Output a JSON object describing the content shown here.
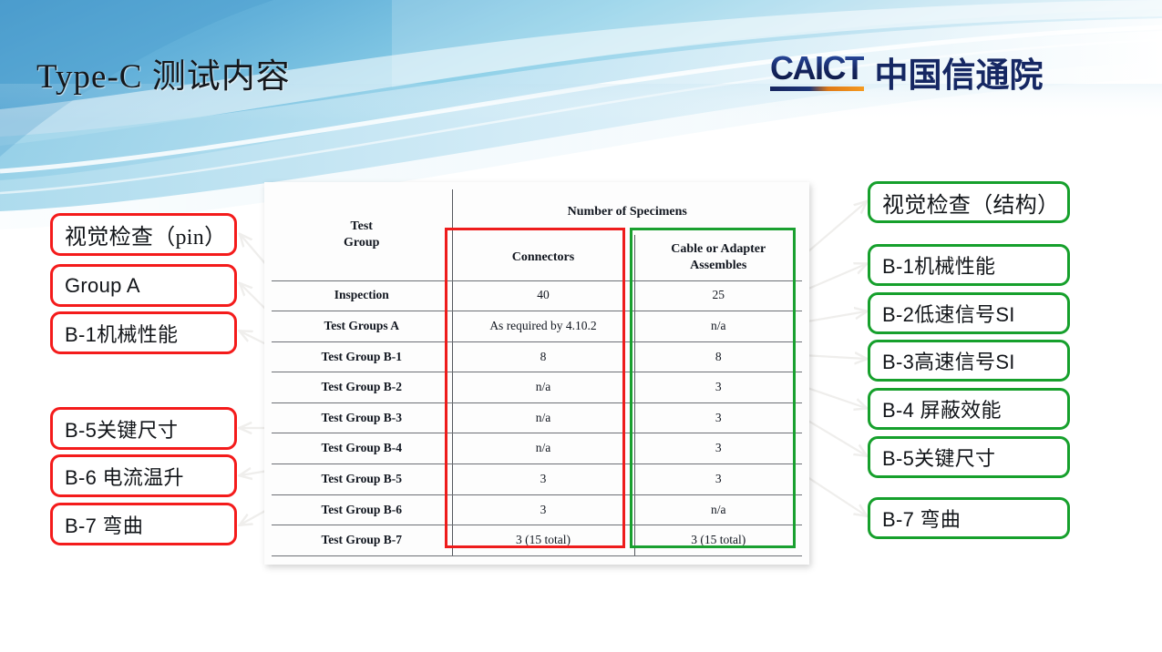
{
  "slide": {
    "title": "Type-C 测试内容",
    "logo": {
      "wordmark": "CAICT",
      "chinese_name": "中国信通院",
      "wordmark_color": "#15255f",
      "accent_color": "#f59a20"
    },
    "background": {
      "theme": "blue-swoosh-gradient",
      "primary": "#6cb4dd",
      "secondary": "#8fd3ea",
      "page": "#ffffff"
    }
  },
  "table": {
    "header_row_1": {
      "test_group": "Test\nGroup",
      "number_of_specimens": "Number of Specimens"
    },
    "header_row_2": {
      "connectors": "Connectors",
      "cable_or_adapter": "Cable or Adapter\nAssembles"
    },
    "columns": [
      "Test Group",
      "Connectors",
      "Cable or Adapter Assembles"
    ],
    "rows": [
      {
        "group": "Inspection",
        "connectors": "40",
        "cable": "25"
      },
      {
        "group": "Test Groups A",
        "connectors": "As required by 4.10.2",
        "cable": "n/a"
      },
      {
        "group": "Test Group B-1",
        "connectors": "8",
        "cable": "8"
      },
      {
        "group": "Test Group B-2",
        "connectors": "n/a",
        "cable": "3"
      },
      {
        "group": "Test Group B-3",
        "connectors": "n/a",
        "cable": "3"
      },
      {
        "group": "Test Group B-4",
        "connectors": "n/a",
        "cable": "3"
      },
      {
        "group": "Test Group B-5",
        "connectors": "3",
        "cable": "3"
      },
      {
        "group": "Test Group B-6",
        "connectors": "3",
        "cable": "n/a"
      },
      {
        "group": "Test Group B-7",
        "connectors": "3 (15 total)",
        "cable": "3 (15 total)"
      }
    ],
    "highlights": {
      "connectors_column_color": "#ee1c1c",
      "cable_column_color": "#1aa030"
    }
  },
  "left_callouts": [
    {
      "label": "视觉检查（pin）",
      "color": "#f41b1b"
    },
    {
      "label": "Group A",
      "color": "#f41b1b"
    },
    {
      "label": "B-1机械性能",
      "color": "#f41b1b"
    },
    {
      "label": "B-5关键尺寸",
      "color": "#f41b1b"
    },
    {
      "label": "B-6 电流温升",
      "color": "#f41b1b"
    },
    {
      "label": "B-7 弯曲",
      "color": "#f41b1b"
    }
  ],
  "right_callouts": [
    {
      "label": "视觉检查（结构）",
      "color": "#16a02c"
    },
    {
      "label": "B-1机械性能",
      "color": "#16a02c"
    },
    {
      "label": "B-2低速信号SI",
      "color": "#16a02c"
    },
    {
      "label": "B-3高速信号SI",
      "color": "#16a02c"
    },
    {
      "label": "B-4 屏蔽效能",
      "color": "#16a02c"
    },
    {
      "label": "B-5关键尺寸",
      "color": "#16a02c"
    },
    {
      "label": "B-7 弯曲",
      "color": "#16a02c"
    }
  ]
}
